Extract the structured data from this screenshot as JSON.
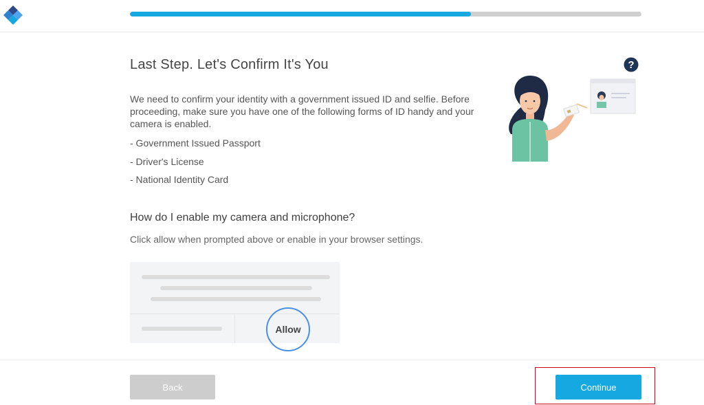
{
  "header": {
    "logo_icon": "diamond-logo-icon",
    "progress": {
      "fraction": 0.667,
      "fill_color": "#16a9e1",
      "track_color": "#cfcfcf"
    }
  },
  "main": {
    "title": "Last Step. Let's Confirm It's You",
    "help_icon": "question-circle-icon",
    "intro": "We need to confirm your identity with a government issued ID and selfie. Before proceeding, make sure you have one of the following forms of ID handy and your camera is enabled.",
    "id_options": [
      "- Government Issued Passport",
      "- Driver's License",
      "- National Identity Card"
    ],
    "camera_heading": "How do I enable my camera and microphone?",
    "camera_text": "Click allow when prompted above or enable in your browser settings.",
    "allow_label": "Allow"
  },
  "footer": {
    "back_label": "Back",
    "continue_label": "Continue"
  },
  "colors": {
    "accent": "#16a9e1",
    "highlight": "#d0021b",
    "help_icon": "#1d3557"
  }
}
